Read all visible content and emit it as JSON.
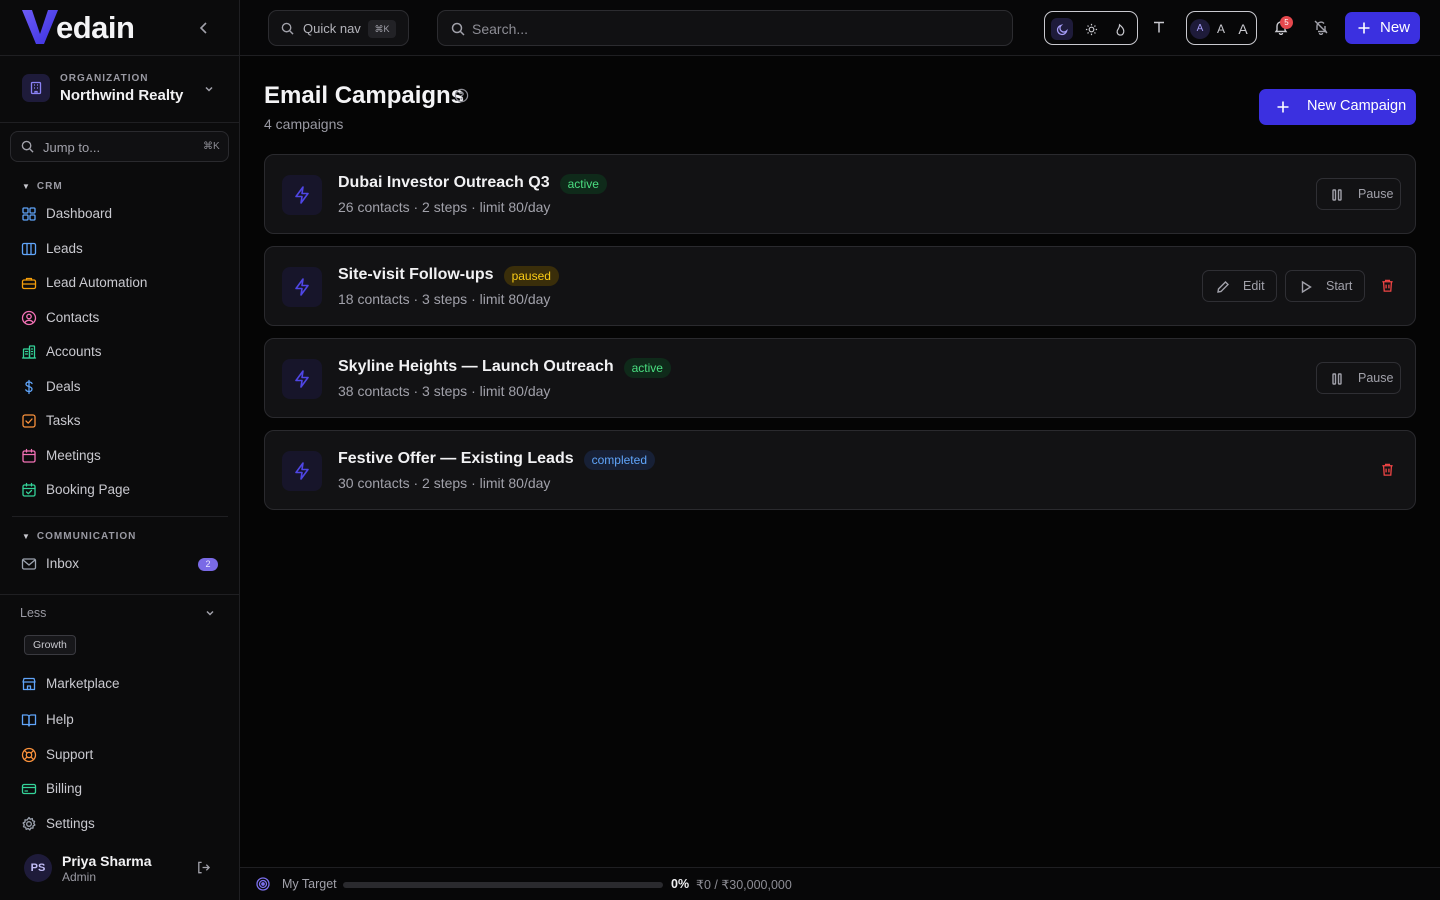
{
  "brand": {
    "name": "edain",
    "accent": "#4f46e5"
  },
  "org": {
    "label": "ORGANIZATION",
    "name": "Northwind Realty"
  },
  "sidebar": {
    "jump_placeholder": "Jump to...",
    "jump_shortcut": "⌘K",
    "crm_title": "CRM",
    "crm_items": [
      {
        "label": "Dashboard",
        "icon": "grid-icon",
        "color": "#60a5fa"
      },
      {
        "label": "Leads",
        "icon": "columns-icon",
        "color": "#60a5fa"
      },
      {
        "label": "Lead Automation",
        "icon": "briefcase-icon",
        "color": "#f59e0b"
      },
      {
        "label": "Contacts",
        "icon": "user-circle-icon",
        "color": "#f472b6"
      },
      {
        "label": "Accounts",
        "icon": "building-icon",
        "color": "#34d399"
      },
      {
        "label": "Deals",
        "icon": "dollar-icon",
        "color": "#60a5fa"
      },
      {
        "label": "Tasks",
        "icon": "checkbox-icon",
        "color": "#fb923c"
      },
      {
        "label": "Meetings",
        "icon": "calendar-icon",
        "color": "#f472b6"
      },
      {
        "label": "Booking Page",
        "icon": "calendar-check-icon",
        "color": "#34d399"
      }
    ],
    "comm_title": "COMMUNICATION",
    "inbox_label": "Inbox",
    "inbox_count": "2",
    "less_label": "Less",
    "plan": "Growth",
    "bottom_items": [
      {
        "label": "Marketplace",
        "icon": "store-icon",
        "color": "#60a5fa"
      },
      {
        "label": "Help",
        "icon": "book-icon",
        "color": "#60a5fa"
      },
      {
        "label": "Support",
        "icon": "lifebuoy-icon",
        "color": "#fb923c"
      },
      {
        "label": "Billing",
        "icon": "credit-card-icon",
        "color": "#34d399"
      },
      {
        "label": "Settings",
        "icon": "gear-icon",
        "color": "#9ca3af"
      }
    ]
  },
  "user": {
    "initials": "PS",
    "name": "Priya Sharma",
    "role": "Admin"
  },
  "topbar": {
    "quicknav_label": "Quick nav",
    "quicknav_shortcut": "⌘K",
    "search_placeholder": "Search...",
    "font_sizes": [
      "A",
      "A",
      "A"
    ],
    "notifications_count": "5",
    "new_label": "New"
  },
  "main": {
    "title": "Email Campaigns",
    "subtitle": "4 campaigns",
    "new_campaign_label": "New Campaign",
    "campaigns": [
      {
        "name": "Dubai Investor Outreach Q3",
        "status": "active",
        "meta": "26 contacts · 2 steps · limit 80/day",
        "actions": [
          "Pause"
        ]
      },
      {
        "name": "Site-visit Follow-ups",
        "status": "paused",
        "meta": "18 contacts · 3 steps · limit 80/day",
        "actions": [
          "Edit",
          "Start"
        ]
      },
      {
        "name": "Skyline Heights — Launch Outreach",
        "status": "active",
        "meta": "38 contacts · 3 steps · limit 80/day",
        "actions": [
          "Pause"
        ]
      },
      {
        "name": "Festive Offer — Existing Leads",
        "status": "completed",
        "meta": "30 contacts · 2 steps · limit 80/day",
        "actions": []
      }
    ]
  },
  "target": {
    "label": "My Target",
    "percent": "0%",
    "progress": 0,
    "amount": "₹0 / ₹30,000,000"
  }
}
